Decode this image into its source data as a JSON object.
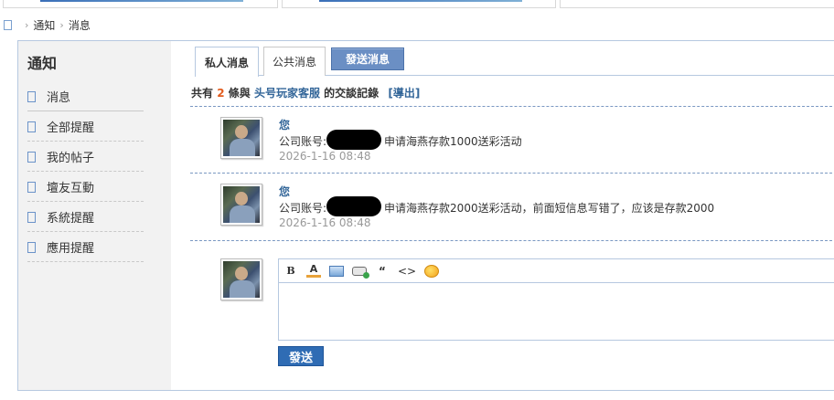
{
  "breadcrumb": {
    "items": [
      "通知",
      "消息"
    ]
  },
  "sidebar": {
    "title": "通知",
    "items": [
      {
        "label": "消息",
        "active": true
      },
      {
        "label": "全部提醒"
      },
      {
        "label": "我的帖子"
      },
      {
        "label": "壇友互動"
      },
      {
        "label": "系統提醒"
      },
      {
        "label": "應用提醒"
      }
    ]
  },
  "tabs": {
    "private": "私人消息",
    "public": "公共消息",
    "send": "發送消息"
  },
  "summary": {
    "prefix": "共有",
    "count": "2",
    "mid": "條與",
    "name": "头号玩家客服",
    "suffix": "的交談記錄",
    "export": "[導出]"
  },
  "messages": [
    {
      "author": "您",
      "body_prefix": "公司账号:",
      "body_text": "申请海燕存款1000送彩活动",
      "time": "2026-1-16 08:48"
    },
    {
      "author": "您",
      "body_prefix": "公司账号:",
      "body_text": "申请海燕存款2000送彩活动，前面短信息写错了，应该是存款2000",
      "time": "2026-1-16 08:48"
    }
  ],
  "editor": {
    "toolbar": {
      "bold": "B",
      "font_color": "A",
      "quote": "“",
      "code": "<>",
      "emoji": ""
    },
    "send_label": "發送"
  },
  "colors": {
    "accent": "#336699",
    "count": "#e25c1e",
    "send_button": "#2f6cb4",
    "tab_send": "#6b8fc4"
  },
  "icons": {
    "home": "home-icon",
    "image": "image-icon",
    "link": "link-icon",
    "emoji": "smiley-icon"
  }
}
